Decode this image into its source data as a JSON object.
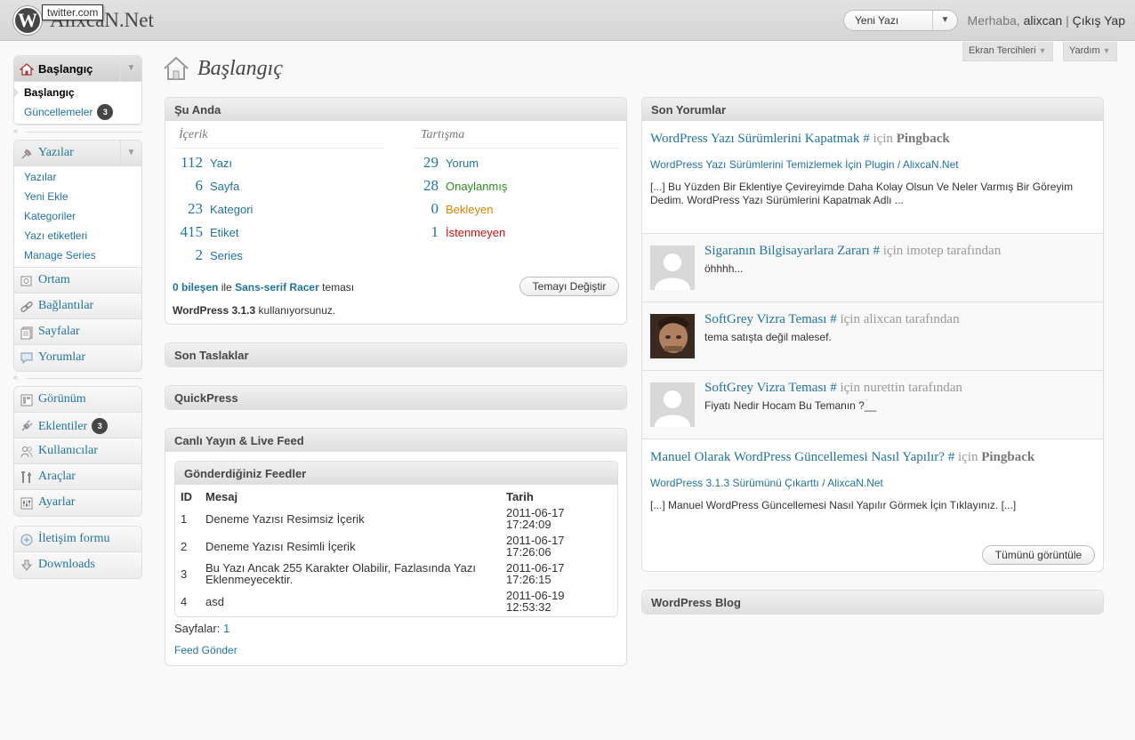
{
  "header": {
    "site_title": "AlixcaN.Net",
    "tooltip": "twitter.com",
    "favorite_action": "Yeni Yazı",
    "greeting": "Merhaba,",
    "username": "alixcan",
    "separator": "|",
    "logout": "Çıkış Yap"
  },
  "screen_options": {
    "screen": "Ekran Tercihleri",
    "help": "Yardım"
  },
  "menu": {
    "dashboard": {
      "label": "Başlangıç",
      "sub": [
        "Başlangıç",
        "Güncellemeler"
      ],
      "updates_count": "3"
    },
    "posts": {
      "label": "Yazılar",
      "sub": [
        "Yazılar",
        "Yeni Ekle",
        "Kategoriler",
        "Yazı etiketleri",
        "Manage Series"
      ]
    },
    "media": "Ortam",
    "links": "Bağlantılar",
    "pages": "Sayfalar",
    "comments": "Yorumlar",
    "appearance": "Görünüm",
    "plugins": {
      "label": "Eklentiler",
      "count": "3"
    },
    "users": "Kullanıcılar",
    "tools": "Araçlar",
    "settings": "Ayarlar",
    "contact": "İletişim formu",
    "downloads": "Downloads"
  },
  "page_title": "Başlangıç",
  "right_now": {
    "title": "Şu Anda",
    "content_heading": "İçerik",
    "discussion_heading": "Tartışma",
    "content": [
      {
        "num": "112",
        "label": "Yazı"
      },
      {
        "num": "6",
        "label": "Sayfa"
      },
      {
        "num": "23",
        "label": "Kategori"
      },
      {
        "num": "415",
        "label": "Etiket"
      },
      {
        "num": "2",
        "label": "Series"
      }
    ],
    "discussion": [
      {
        "num": "29",
        "label": "Yorum"
      },
      {
        "num": "28",
        "label": "Onaylanmış"
      },
      {
        "num": "0",
        "label": "Bekleyen"
      },
      {
        "num": "1",
        "label": "İstenmeyen"
      }
    ],
    "widgets": "0 bileşen",
    "with": "ile",
    "theme_name": "Sans-serif Racer",
    "theme_word": "teması",
    "change_theme": "Temayı Değiştir",
    "version": "WordPress 3.1.3",
    "using": "kullanıyorsunuz."
  },
  "drafts_title": "Son Taslaklar",
  "quickpress_title": "QuickPress",
  "feed_box": {
    "title": "Canlı Yayın & Live Feed",
    "inner_title": "Gönderdiğiniz Feedler",
    "columns": [
      "ID",
      "Mesaj",
      "Tarih"
    ],
    "rows": [
      {
        "id": "1",
        "msg": "Deneme Yazısı Resimsiz İçerik",
        "date": "2011-06-17",
        "time": "17:24:09"
      },
      {
        "id": "2",
        "msg": "Deneme Yazısı Resimli İçerik",
        "date": "2011-06-17",
        "time": "17:26:06"
      },
      {
        "id": "3",
        "msg": "Bu Yazı Ancak 255 Karakter Olabilir, Fazlasında Yazı Eklenmeyecektir.",
        "date": "2011-06-17",
        "time": "17:26:15"
      },
      {
        "id": "4",
        "msg": "asd",
        "date": "2011-06-19",
        "time": "12:53:32"
      }
    ],
    "pages_label": "Sayfalar:",
    "page_num": "1",
    "send_feed": "Feed Gönder"
  },
  "recent_comments": {
    "title": "Son Yorumlar",
    "c1": {
      "post": "WordPress Yazı Sürümlerini Kapatmak",
      "hash": "#",
      "meta": "için",
      "type": "Pingback",
      "link": "WordPress Yazı Sürümlerini Temizlemek İçin Plugin / AlixcaN.Net",
      "body": "[...] Bu Yüzden Bir Eklentiye Çevireyimde Daha Kolay Olsun Ve Neler Varmış Bir Göreyim Dedim. WordPress Yazı Sürümlerini Kapatmak Adlı ..."
    },
    "c2": {
      "post": "Sigaranın Bilgisayarlara Zararı",
      "hash": "#",
      "meta": "için imotep tarafından",
      "body": "öhhhh..."
    },
    "c3": {
      "post": "SoftGrey Vizra Teması",
      "hash": "#",
      "meta": "için alixcan tarafından",
      "body": "tema satışta değil malesef."
    },
    "c4": {
      "post": "SoftGrey Vizra Teması",
      "hash": "#",
      "meta": "için nurettin tarafından",
      "body": "Fiyatı Nedir Hocam Bu Temanın ?__"
    },
    "c5": {
      "post": "Manuel Olarak WordPress Güncellemesi Nasıl Yapılır?",
      "hash": "#",
      "meta": "için",
      "type": "Pingback",
      "link": "WordPress 3.1.3 Sürümünü Çıkarttı / AlixcaN.Net",
      "body": "[...] Manuel WordPress Güncellemesi Nasıl Yapılır Görmek İçin Tıklayınız. [...]"
    },
    "view_all": "Tümünü görüntüle"
  },
  "wp_blog_title": "WordPress Blog"
}
